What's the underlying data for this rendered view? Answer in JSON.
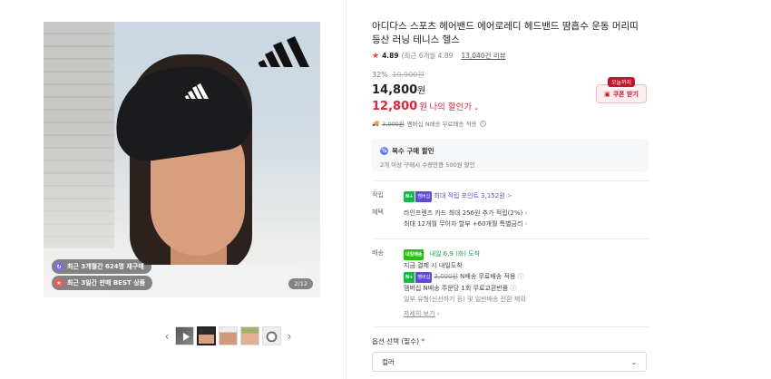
{
  "gallery": {
    "badges": [
      {
        "icon": "repurchase-icon",
        "text": "최근 3개월간 624명 재구매"
      },
      {
        "icon": "best-icon",
        "text": "최근 3일간 판매 BEST 상품"
      }
    ],
    "counter": "2/12",
    "prev_label": "‹",
    "next_label": "›"
  },
  "product": {
    "title": "아디다스 스포츠 헤어밴드 에어로레디 헤드밴드 땀흡수 운동 머리띠 등산 러닝 테니스 헬스",
    "rating": {
      "score": "4.89",
      "sub": "(최근 6개월 4.89",
      "reviews": "13,040건 리뷰"
    },
    "discount_pct": "32%",
    "original_price": "19,900원",
    "price": "14,800",
    "price_unit": "원",
    "my_price": "12,800",
    "my_price_unit": "원",
    "my_price_label": "나의 할인가",
    "coupon": {
      "tag": "오늘까지",
      "label": "쿠폰 받기"
    },
    "shipping_line": {
      "orig": "3,000원",
      "text": "멤버십 N배송 무료배송 적용"
    },
    "bulk": {
      "title": "복수 구매 할인",
      "desc": "2개 이상 구매시 수량만큼 500원 할인"
    },
    "points": {
      "key": "적립",
      "badge_n": "N+",
      "badge_p": "멤버십",
      "text": "최대 적립 포인트 3,152원",
      "arrow": ">"
    },
    "benefits": {
      "key": "혜택",
      "lines": [
        "라인프렌즈 카드 최대 256원 추가 적립(2%)",
        "최대 12개월 무이자 할부 +60개월 특별금리"
      ]
    },
    "delivery": {
      "key": "배송",
      "badge": "내일배송",
      "eta": "내일 6.9 (화) 도착",
      "line1": "지금 결제 시 내일도착",
      "line2_orig": "3,000원",
      "line2": "N배송 무료배송 적용",
      "line3": "멤버십 N배송 주문당 1회 무료교환반품",
      "line4": "일부 유형(신선하기 등) 및 일반배송 전환 제외",
      "more": "자세히 보기"
    },
    "option": {
      "label": "옵션 선택 (필수)",
      "required_mark": "*",
      "selected": "컬러"
    }
  }
}
